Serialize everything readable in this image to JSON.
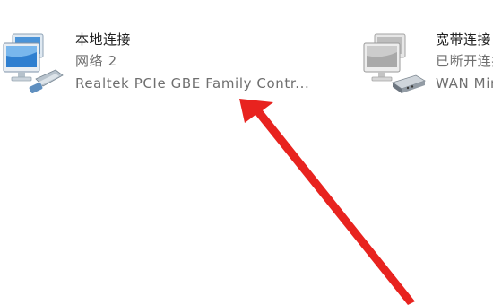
{
  "adapters": [
    {
      "name": "本地连接",
      "status": "网络  2",
      "device": "Realtek PCIe GBE Family Contr...",
      "icon": "monitor-network-adapter-icon"
    },
    {
      "name": "宽带连接",
      "status": "已断开连接",
      "device": "WAN Miniport (PPPOE)",
      "icon": "monitor-modem-icon"
    }
  ],
  "annotation": {
    "arrow_color": "#e8231f"
  }
}
